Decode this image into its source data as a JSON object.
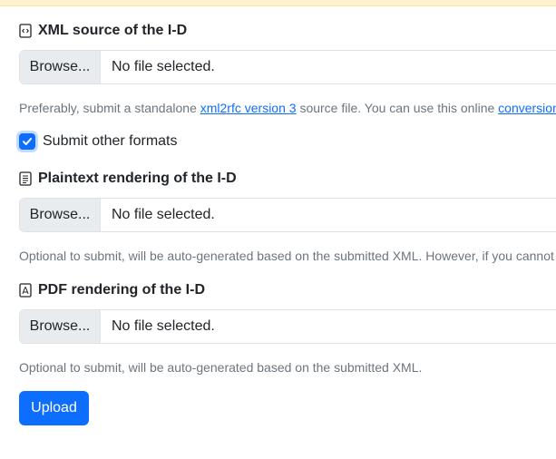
{
  "xml_section": {
    "label": "XML source of the I-D",
    "icon": "file-code-icon",
    "browse_label": "Browse...",
    "file_status": "No file selected.",
    "help_prefix": "Preferably, submit a standalone ",
    "help_link1": "xml2rfc version 3",
    "help_middle": " source file. You can use this online ",
    "help_link2": "conversion s"
  },
  "submit_other": {
    "label": "Submit other formats",
    "checked": true
  },
  "plaintext_section": {
    "label": "Plaintext rendering of the I-D",
    "icon": "file-text-icon",
    "browse_label": "Browse...",
    "file_status": "No file selected.",
    "help": "Optional to submit, will be auto-generated based on the submitted XML. However, if you cannot"
  },
  "pdf_section": {
    "label": "PDF rendering of the I-D",
    "icon": "file-pdf-icon",
    "browse_label": "Browse...",
    "file_status": "No file selected.",
    "help": "Optional to submit, will be auto-generated based on the submitted XML."
  },
  "upload_button": {
    "label": "Upload"
  },
  "colors": {
    "primary": "#0d6efd",
    "muted": "#6c757d",
    "warning_bg": "#fff3cd"
  }
}
